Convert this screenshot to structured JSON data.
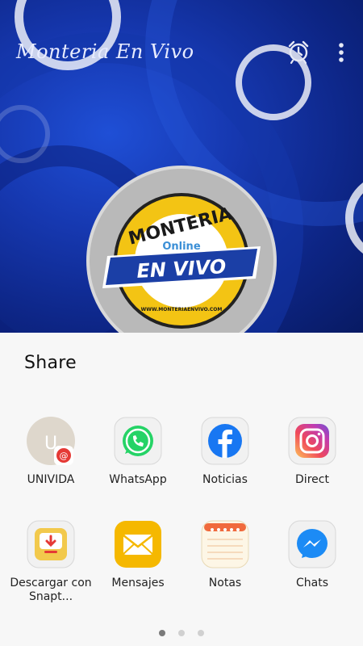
{
  "app": {
    "title": "Monteria En Vivo",
    "logo": {
      "line1": "MONTERIA",
      "line2": "Online",
      "line3": "EN VIVO",
      "url": "WWW.MONTERIAENVIVO.COM"
    }
  },
  "share": {
    "title": "Share",
    "targets": [
      {
        "label": "UNIVIDA",
        "icon": "univida-icon"
      },
      {
        "label": "WhatsApp",
        "icon": "whatsapp-icon"
      },
      {
        "label": "Noticias",
        "icon": "facebook-icon"
      },
      {
        "label": "Direct",
        "icon": "instagram-icon"
      },
      {
        "label": "Descargar con Snapt...",
        "icon": "snaptube-icon"
      },
      {
        "label": "Mensajes",
        "icon": "envelope-icon"
      },
      {
        "label": "Notas",
        "icon": "notes-icon"
      },
      {
        "label": "Chats",
        "icon": "messenger-icon"
      }
    ]
  },
  "pager": {
    "pages": 3,
    "current": 1
  },
  "colors": {
    "whatsapp": "#25d366",
    "facebook": "#1877f2",
    "messages": "#f5b800",
    "snaptube": "#f2c94c"
  }
}
